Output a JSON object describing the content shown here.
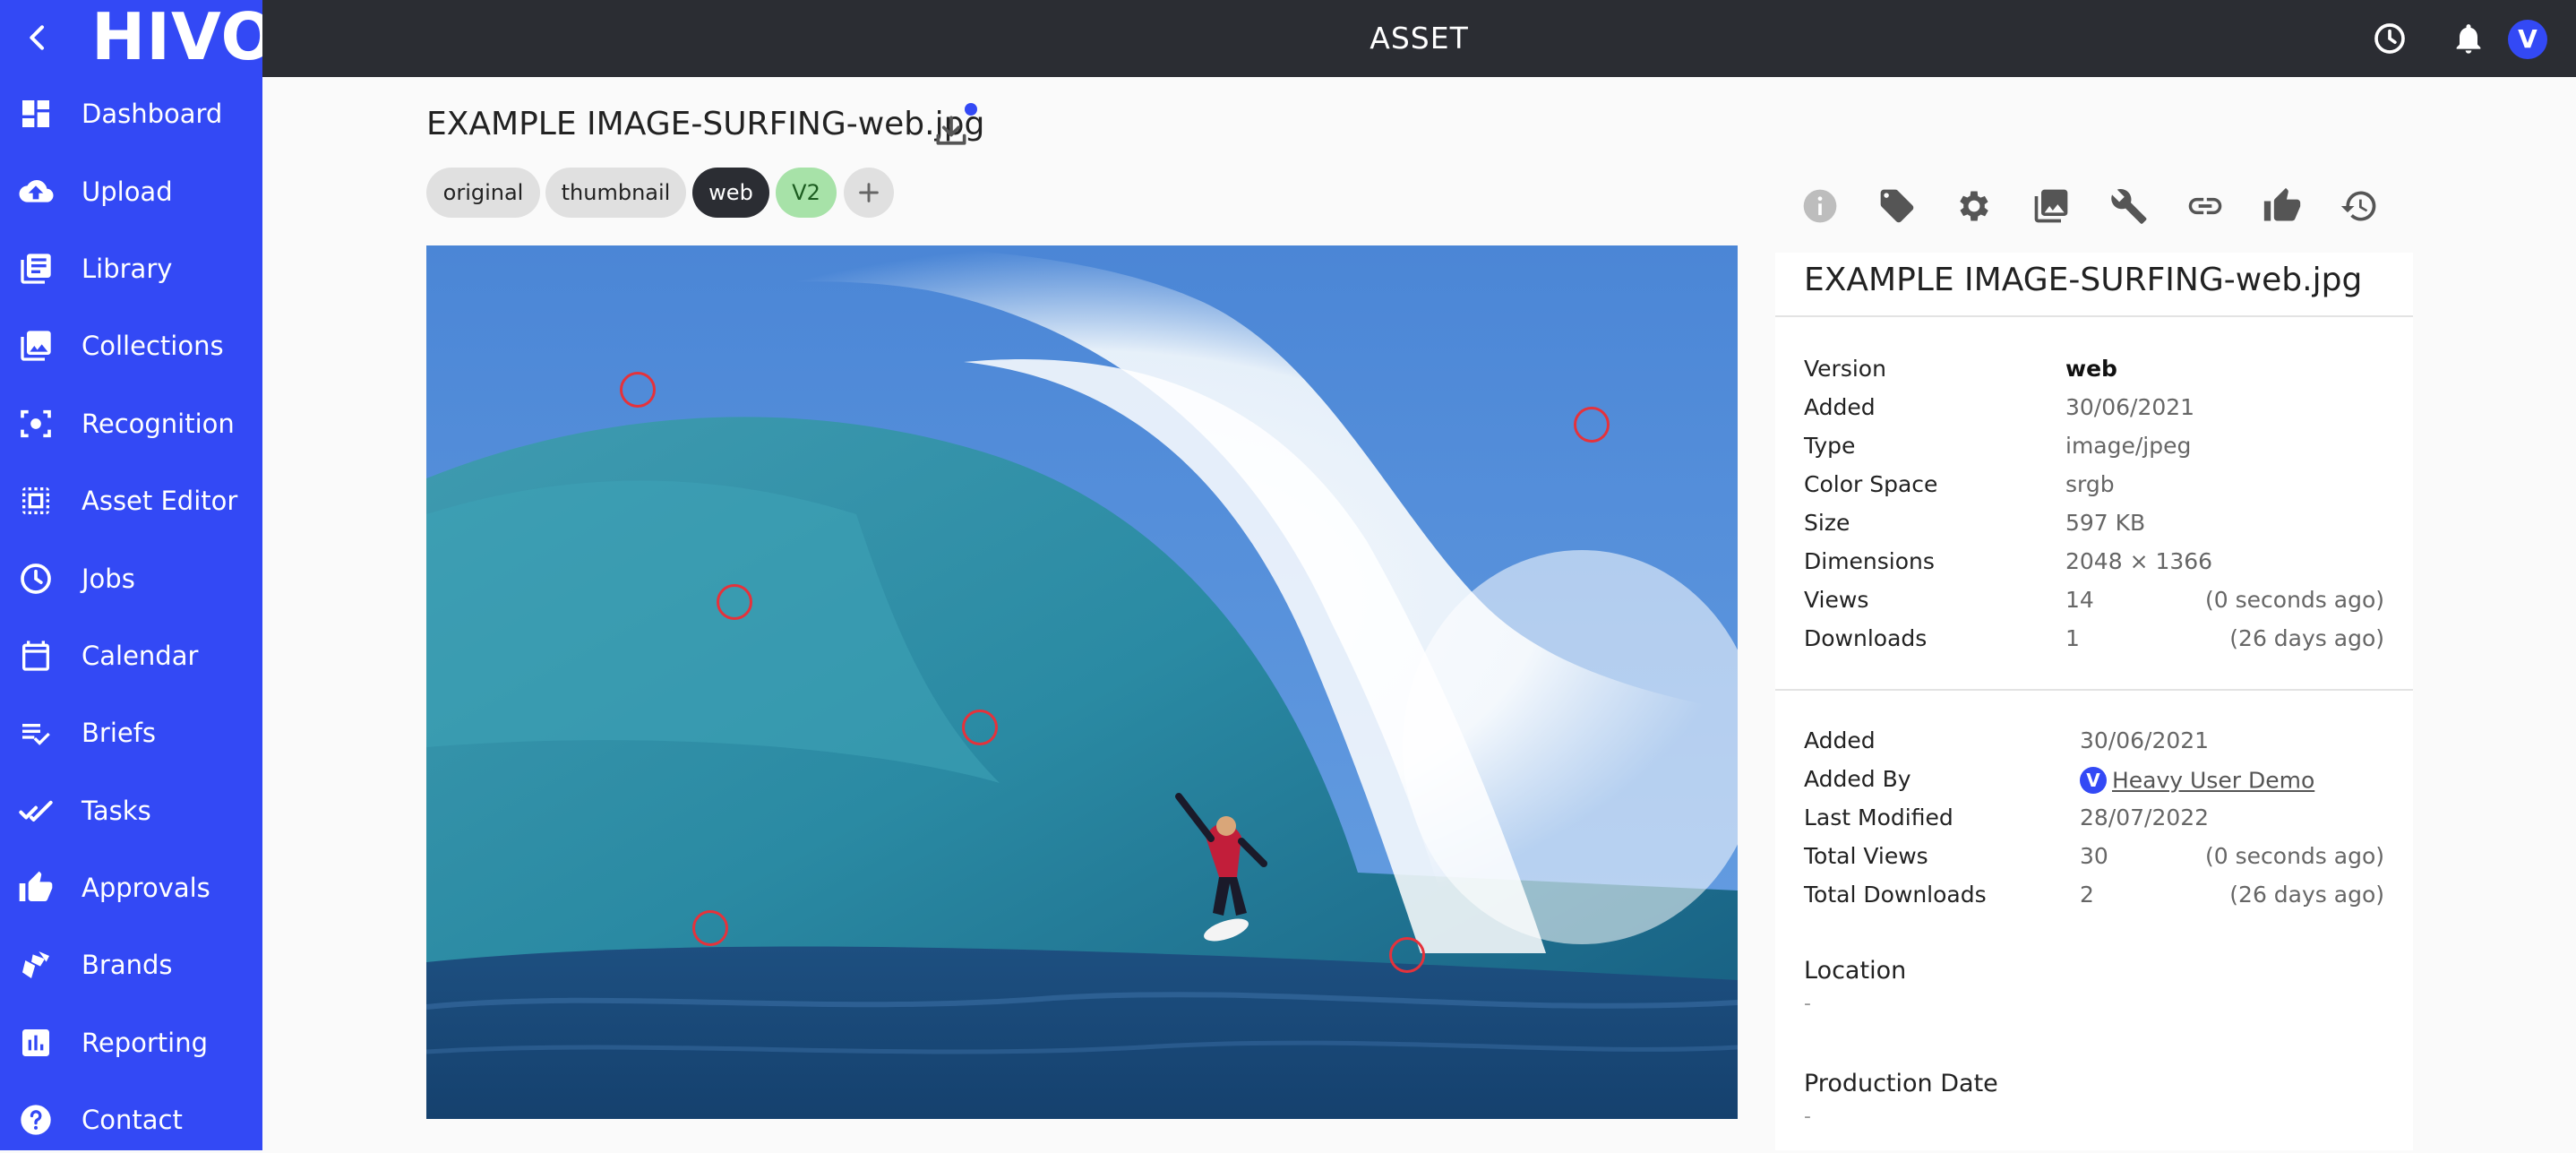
{
  "app": {
    "logo": "HIVO",
    "header_title": "ASSET",
    "avatar_initial": "V"
  },
  "sidebar": {
    "items": [
      {
        "label": "Dashboard",
        "icon": "dashboard-icon"
      },
      {
        "label": "Upload",
        "icon": "cloud-upload-icon"
      },
      {
        "label": "Library",
        "icon": "library-icon"
      },
      {
        "label": "Collections",
        "icon": "collections-icon"
      },
      {
        "label": "Recognition",
        "icon": "face-recognition-icon"
      },
      {
        "label": "Asset Editor",
        "icon": "asset-editor-icon"
      },
      {
        "label": "Jobs",
        "icon": "clock-icon"
      },
      {
        "label": "Calendar",
        "icon": "calendar-icon"
      },
      {
        "label": "Briefs",
        "icon": "briefs-icon"
      },
      {
        "label": "Tasks",
        "icon": "tasks-icon"
      },
      {
        "label": "Approvals",
        "icon": "thumbs-up-icon"
      },
      {
        "label": "Brands",
        "icon": "brands-icon"
      },
      {
        "label": "Reporting",
        "icon": "reporting-icon"
      },
      {
        "label": "Contact",
        "icon": "help-icon"
      }
    ]
  },
  "asset": {
    "filename": "EXAMPLE IMAGE-SURFING-web.jpg",
    "renditions": [
      "original",
      "thumbnail",
      "web"
    ],
    "active_rendition": "web",
    "version_badge": "V2"
  },
  "details": {
    "title": "EXAMPLE IMAGE-SURFING-web.jpg",
    "file_info": [
      {
        "key": "Version",
        "value": "web"
      },
      {
        "key": "Added",
        "value": "30/06/2021"
      },
      {
        "key": "Type",
        "value": "image/jpeg"
      },
      {
        "key": "Color Space",
        "value": "srgb"
      },
      {
        "key": "Size",
        "value": "597 KB"
      },
      {
        "key": "Dimensions",
        "value": "2048 × 1366"
      },
      {
        "key": "Views",
        "value": "14",
        "extra": "(0 seconds ago)"
      },
      {
        "key": "Downloads",
        "value": "1",
        "extra": "(26 days ago)"
      }
    ],
    "asset_info": [
      {
        "key": "Added",
        "value": "30/06/2021"
      },
      {
        "key": "Added By",
        "value": "Heavy User Demo",
        "avatar": "V"
      },
      {
        "key": "Last Modified",
        "value": "28/07/2022"
      },
      {
        "key": "Total Views",
        "value": "30",
        "extra": "(0 seconds ago)"
      },
      {
        "key": "Total Downloads",
        "value": "2",
        "extra": "(26 days ago)"
      }
    ],
    "location": {
      "label": "Location",
      "value": "-"
    },
    "production_date": {
      "label": "Production Date",
      "value": "-"
    }
  },
  "colors": {
    "brand": "#3349f5",
    "topbar": "#2b2d33",
    "marker": "#e5323b",
    "version_badge": "#a7e2a8"
  }
}
